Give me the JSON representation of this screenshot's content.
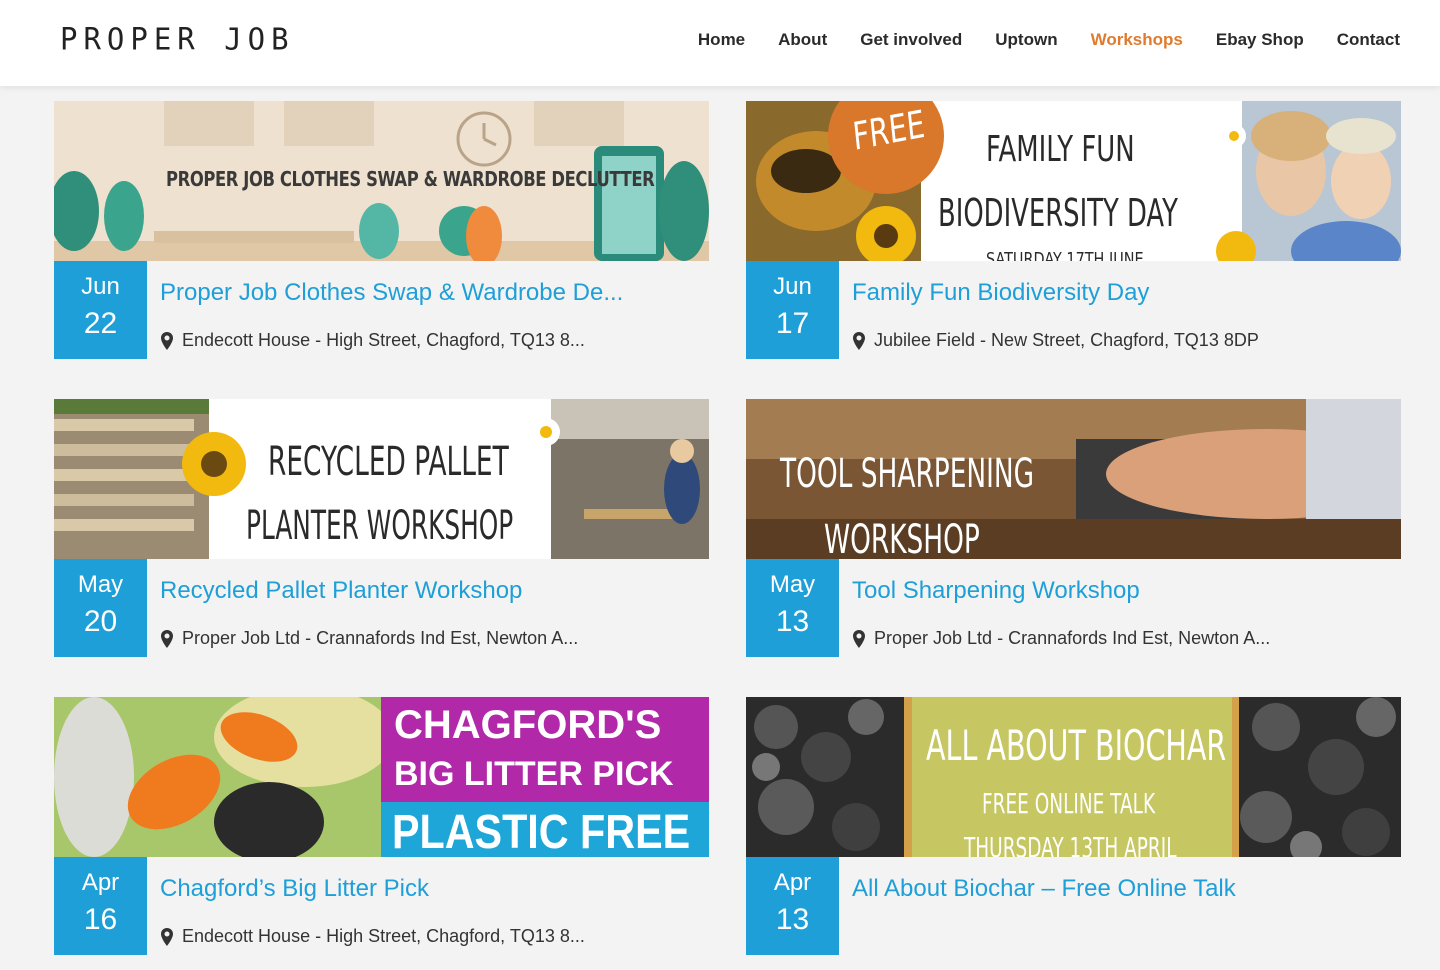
{
  "site": {
    "logo": "PROPER JOB"
  },
  "nav": [
    {
      "label": "Home",
      "active": false
    },
    {
      "label": "About",
      "active": false
    },
    {
      "label": "Get involved",
      "active": false
    },
    {
      "label": "Uptown",
      "active": false
    },
    {
      "label": "Workshops",
      "active": true
    },
    {
      "label": "Ebay Shop",
      "active": false
    },
    {
      "label": "Contact",
      "active": false
    }
  ],
  "colors": {
    "accent": "#1e9fd8",
    "nav_active": "#e07a2c"
  },
  "events": [
    {
      "month": "Jun",
      "day": "22",
      "title": "Proper Job Clothes Swap & Wardrobe De...",
      "location": "Endecott House - High Street, Chagford, TQ13 8...",
      "banner": {
        "lines": [
          "PROPER JOB CLOTHES SWAP & WARDROBE DECLUTTER"
        ]
      }
    },
    {
      "month": "Jun",
      "day": "17",
      "title": "Family Fun Biodiversity Day",
      "location": "Jubilee Field - New Street, Chagford, TQ13 8DP",
      "banner": {
        "lines": [
          "FREE",
          "FAMILY FUN",
          "BIODIVERSITY DAY",
          "SATURDAY 17TH JUNE"
        ]
      }
    },
    {
      "month": "May",
      "day": "20",
      "title": "Recycled Pallet Planter Workshop",
      "location": "Proper Job Ltd - Crannafords Ind Est, Newton A...",
      "banner": {
        "lines": [
          "RECYCLED PALLET",
          "PLANTER  WORKSHOP"
        ]
      }
    },
    {
      "month": "May",
      "day": "13",
      "title": "Tool Sharpening Workshop",
      "location": "Proper Job Ltd - Crannafords Ind Est, Newton A...",
      "banner": {
        "lines": [
          "TOOL SHARPENING",
          "WORKSHOP"
        ]
      }
    },
    {
      "month": "Apr",
      "day": "16",
      "title": "Chagford’s Big Litter Pick",
      "location": "Endecott House - High Street, Chagford, TQ13 8...",
      "banner": {
        "lines": [
          "CHAGFORD'S",
          "BIG LITTER PICK",
          "PLASTIC FREE"
        ]
      }
    },
    {
      "month": "Apr",
      "day": "13",
      "title": "All About Biochar – Free Online Talk",
      "location": "",
      "banner": {
        "lines": [
          "ALL ABOUT BIOCHAR",
          "FREE ONLINE TALK",
          "THURSDAY 13TH APRIL"
        ]
      }
    }
  ]
}
